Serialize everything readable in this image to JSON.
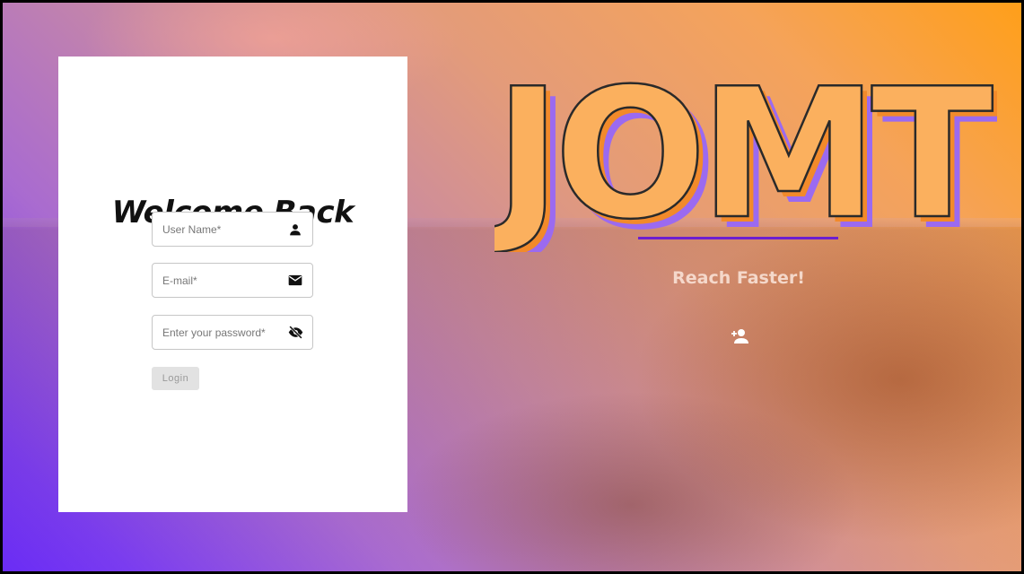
{
  "login": {
    "title": "Welcome Back",
    "fields": {
      "username": {
        "placeholder": "User Name*",
        "icon": "person-icon"
      },
      "email": {
        "placeholder": "E-mail*",
        "icon": "envelope-icon"
      },
      "password": {
        "placeholder": "Enter your password*",
        "icon": "eye-off-icon"
      }
    },
    "button_label": "Login"
  },
  "brand": {
    "logo_text": "JOMT",
    "tagline": "Reach Faster!",
    "underline_color": "#6c1fd0",
    "logo_fill": "#fbb05e",
    "logo_shadow": "#9b6af0"
  },
  "actions": {
    "signup_icon": "add-user-icon"
  }
}
